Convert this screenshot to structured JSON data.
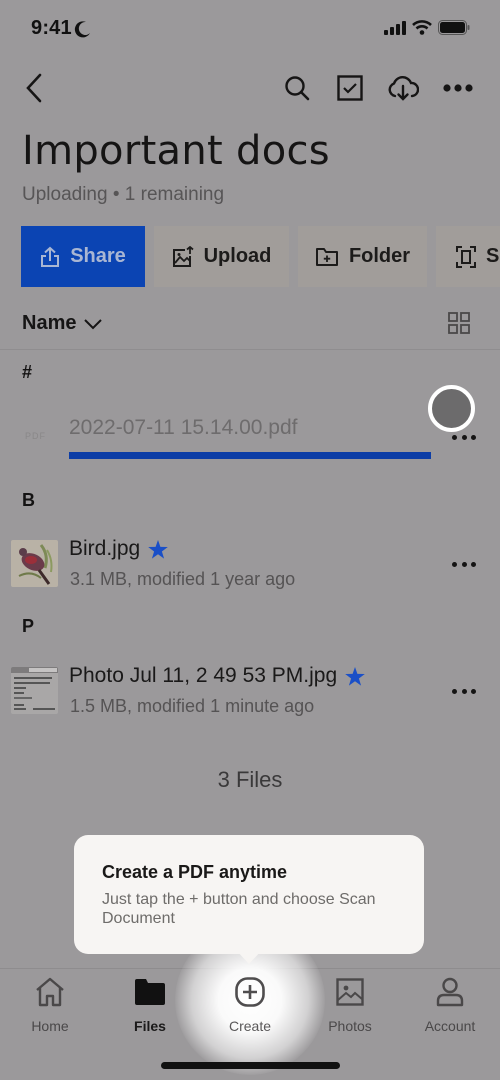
{
  "status_bar": {
    "time": "9:41",
    "moon_icon": "moon-icon",
    "signal_icon": "cellular-signal-icon",
    "wifi_icon": "wifi-icon",
    "battery_icon": "battery-icon"
  },
  "nav": {
    "back_icon": "chevron-left-icon",
    "search_icon": "search-icon",
    "select_icon": "checkbox-icon",
    "offline_icon": "cloud-download-icon",
    "more_icon": "ellipsis-icon"
  },
  "header": {
    "title": "Important docs",
    "subtitle": "Uploading • 1 remaining"
  },
  "actions": [
    {
      "label": "Share",
      "icon": "share-icon"
    },
    {
      "label": "Upload",
      "icon": "upload-image-icon"
    },
    {
      "label": "Folder",
      "icon": "new-folder-icon"
    },
    {
      "label": "Scan",
      "icon": "scan-icon",
      "visible_label": "S"
    }
  ],
  "sort": {
    "label": "Name",
    "icon": "chevron-down-icon",
    "view_toggle_icon": "grid-view-icon"
  },
  "sections": [
    {
      "label": "#",
      "files": [
        {
          "name": "2022-07-11 15.14.00.pdf",
          "thumb_label": "PDF",
          "uploading": true,
          "progress": 1.0
        }
      ]
    },
    {
      "label": "B",
      "files": [
        {
          "name": "Bird.jpg",
          "starred": true,
          "meta": "3.1 MB, modified 1 year ago"
        }
      ]
    },
    {
      "label": "P",
      "files": [
        {
          "name": "Photo Jul 11, 2 49 53 PM.jpg",
          "starred": true,
          "meta": "1.5 MB, modified 1 minute ago"
        }
      ]
    }
  ],
  "files_count": "3 Files",
  "tooltip": {
    "title": "Create a PDF anytime",
    "body": "Just tap the + button and choose Scan Document"
  },
  "tabs": [
    {
      "label": "Home",
      "icon": "home-icon"
    },
    {
      "label": "Files",
      "icon": "folder-icon",
      "active": true
    },
    {
      "label": "Create",
      "icon": "plus-circle-icon"
    },
    {
      "label": "Photos",
      "icon": "photo-icon"
    },
    {
      "label": "Account",
      "icon": "person-icon"
    }
  ],
  "colors": {
    "accent": "#0b44b3",
    "star": "#1a4fc7",
    "progress": "#0c3da6",
    "overlay_bg": "#9b999b"
  }
}
